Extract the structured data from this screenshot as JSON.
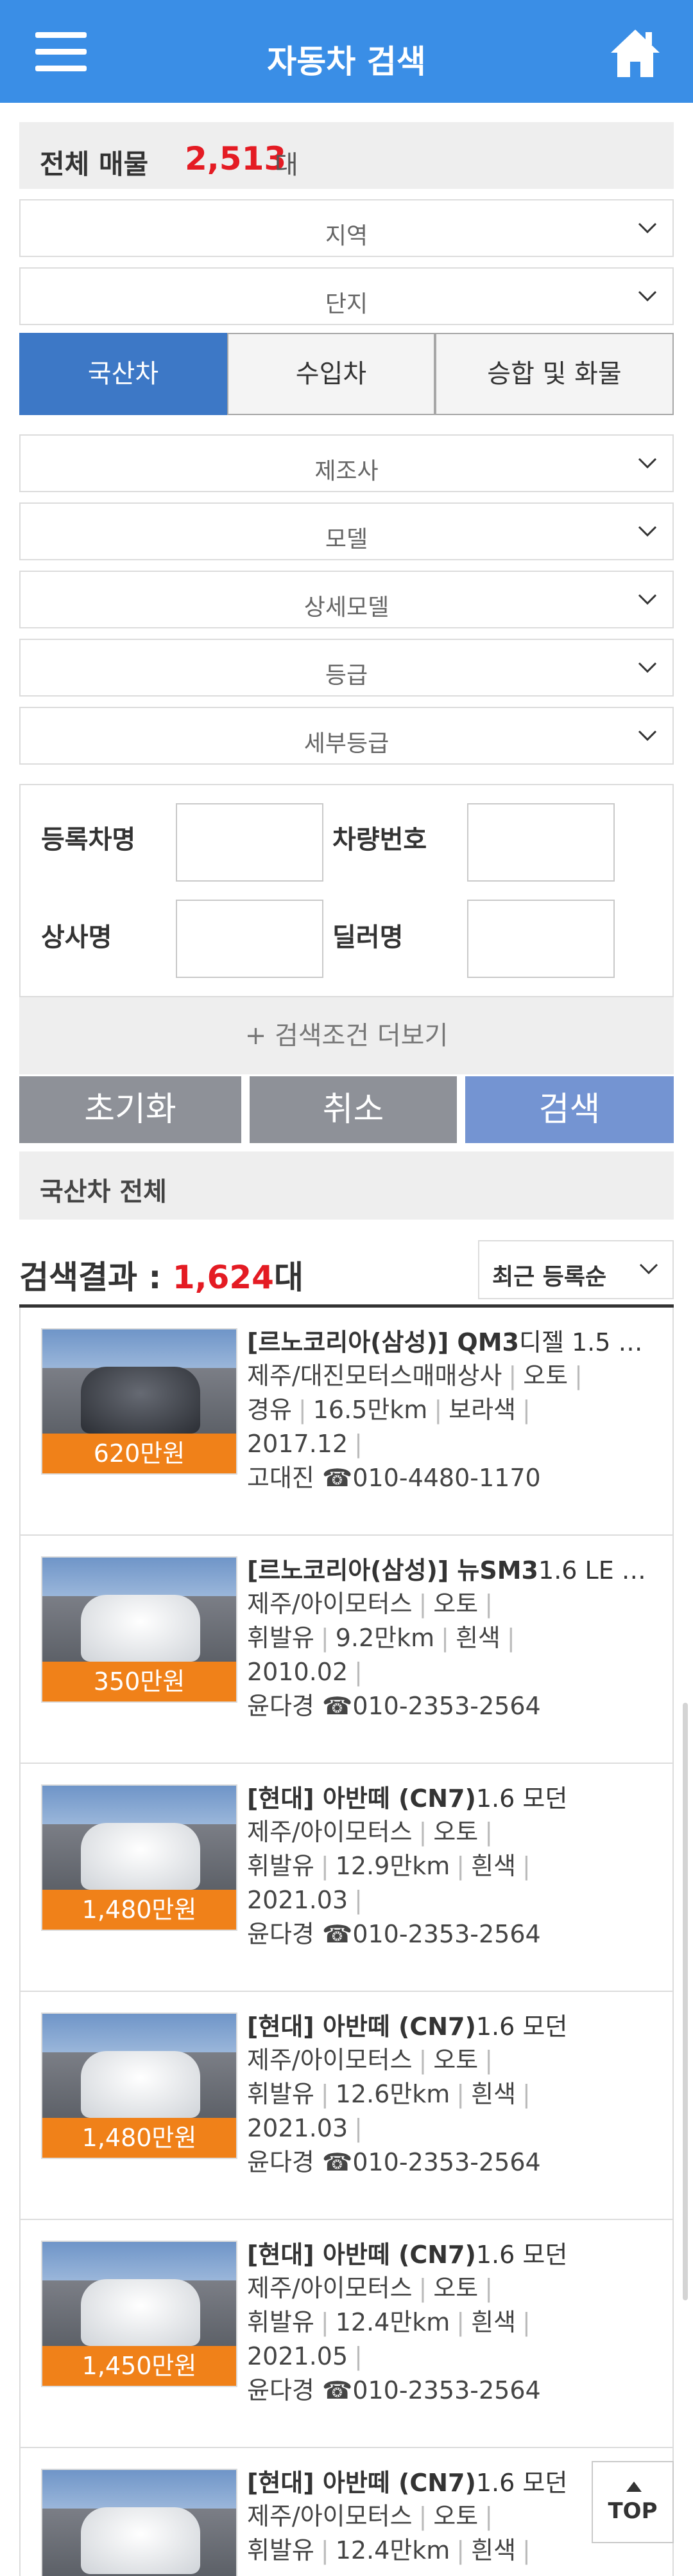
{
  "header": {
    "title": "자동차 검색"
  },
  "total": {
    "label": "전체 매물",
    "count": "2,513",
    "unit": "대"
  },
  "filters": {
    "region": "지역",
    "complex": "단지"
  },
  "tabs": [
    "국산차",
    "수입차",
    "승합 및 화물"
  ],
  "selects": [
    "제조사",
    "모델",
    "상세모델",
    "등급",
    "세부등급"
  ],
  "inputs": {
    "reg_name": "등록차명",
    "car_no": "차량번호",
    "company": "상사명",
    "dealer": "딜러명"
  },
  "more_label": "+ 검색조건 더보기",
  "buttons": {
    "reset": "초기화",
    "cancel": "취소",
    "search": "검색"
  },
  "category_label": "국산차 전체",
  "result": {
    "label": "검색결과 : ",
    "count": "1,624",
    "unit": "대"
  },
  "sort": {
    "value": "최근 등록순"
  },
  "colors": {
    "header": "#3a8ee6",
    "accent_red": "#e41b23",
    "price_orange": "#f08119",
    "active_tab": "#3d78c6"
  },
  "listings": [
    {
      "price": "620만원",
      "title_bold": "[르노코리아(삼성)] QM3",
      "title_rest": "디젤 1.5 …",
      "dealer_shop": "제주/대진모터스매매상사",
      "transmission": "오토",
      "fuel": "경유",
      "mileage": "16.5만km",
      "color": "보라색",
      "date": "2017.12",
      "dealer": "고대진",
      "phone": "010-4480-1170"
    },
    {
      "price": "350만원",
      "title_bold": "[르노코리아(삼성)] 뉴SM3",
      "title_rest": "1.6 LE …",
      "dealer_shop": "제주/아이모터스",
      "transmission": "오토",
      "fuel": "휘발유",
      "mileage": "9.2만km",
      "color": "흰색",
      "date": "2010.02",
      "dealer": "윤다경",
      "phone": "010-2353-2564"
    },
    {
      "price": "1,480만원",
      "title_bold": "[현대] 아반떼 (CN7)",
      "title_rest": "1.6 모던",
      "dealer_shop": "제주/아이모터스",
      "transmission": "오토",
      "fuel": "휘발유",
      "mileage": "12.9만km",
      "color": "흰색",
      "date": "2021.03",
      "dealer": "윤다경",
      "phone": "010-2353-2564"
    },
    {
      "price": "1,480만원",
      "title_bold": "[현대] 아반떼 (CN7)",
      "title_rest": "1.6 모던",
      "dealer_shop": "제주/아이모터스",
      "transmission": "오토",
      "fuel": "휘발유",
      "mileage": "12.6만km",
      "color": "흰색",
      "date": "2021.03",
      "dealer": "윤다경",
      "phone": "010-2353-2564"
    },
    {
      "price": "1,450만원",
      "title_bold": "[현대] 아반떼 (CN7)",
      "title_rest": "1.6 모던",
      "dealer_shop": "제주/아이모터스",
      "transmission": "오토",
      "fuel": "휘발유",
      "mileage": "12.4만km",
      "color": "흰색",
      "date": "2021.05",
      "dealer": "윤다경",
      "phone": "010-2353-2564"
    },
    {
      "price": "",
      "title_bold": "[현대] 아반떼 (CN7)",
      "title_rest": "1.6 모던",
      "dealer_shop": "제주/아이모터스",
      "transmission": "오토",
      "fuel": "휘발유",
      "mileage": "12.4만km",
      "color": "흰색",
      "date": "",
      "dealer": "",
      "phone": ""
    }
  ],
  "top_button": "TOP"
}
